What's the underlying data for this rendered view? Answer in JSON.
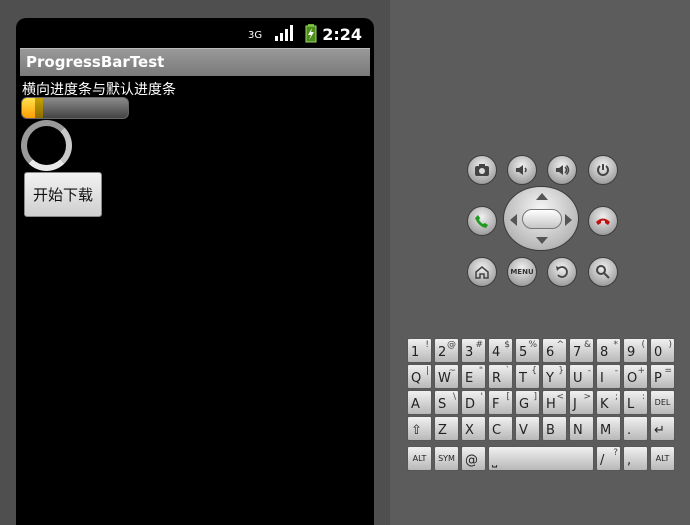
{
  "status_bar": {
    "network_icon": "3g-icon",
    "signal_icon": "signal-icon",
    "battery_icon": "battery-charging-icon",
    "time": "2:24"
  },
  "app": {
    "title": "ProgressBarTest",
    "label": "横向进度条与默认进度条",
    "progress": {
      "primary_fraction": 0.12,
      "secondary_fraction": 0.2,
      "colors": {
        "primary": "#ff9d00",
        "secondary": "#b38d00",
        "track": "#6b6b6b"
      }
    },
    "spinner_icon": "spinner-icon",
    "button_label": "开始下载"
  },
  "emulator": {
    "buttons": {
      "camera": "camera-icon",
      "volume_down": "volume-down-icon",
      "volume_up": "volume-up-icon",
      "power": "power-icon",
      "call": "call-icon",
      "end_call": "end-call-icon",
      "home": "home-icon",
      "menu_label": "MENU",
      "back": "back-icon",
      "search": "search-icon"
    },
    "keyboard": {
      "row1": [
        {
          "k": "1",
          "s": "!"
        },
        {
          "k": "2",
          "s": "@"
        },
        {
          "k": "3",
          "s": "#"
        },
        {
          "k": "4",
          "s": "$"
        },
        {
          "k": "5",
          "s": "%"
        },
        {
          "k": "6",
          "s": "^"
        },
        {
          "k": "7",
          "s": "&"
        },
        {
          "k": "8",
          "s": "*"
        },
        {
          "k": "9",
          "s": "("
        },
        {
          "k": "0",
          "s": ")"
        }
      ],
      "row2": [
        {
          "k": "Q",
          "s": "|"
        },
        {
          "k": "W",
          "s": "~"
        },
        {
          "k": "E",
          "s": "\""
        },
        {
          "k": "R",
          "s": "`"
        },
        {
          "k": "T",
          "s": "{"
        },
        {
          "k": "Y",
          "s": "}"
        },
        {
          "k": "U",
          "s": "-"
        },
        {
          "k": "I",
          "s": "-"
        },
        {
          "k": "O",
          "s": "+"
        },
        {
          "k": "P",
          "s": "="
        }
      ],
      "row3": [
        {
          "k": "A",
          "s": ""
        },
        {
          "k": "S",
          "s": "\\"
        },
        {
          "k": "D",
          "s": "'"
        },
        {
          "k": "F",
          "s": "["
        },
        {
          "k": "G",
          "s": "]"
        },
        {
          "k": "H",
          "s": "<"
        },
        {
          "k": "J",
          "s": ">"
        },
        {
          "k": "K",
          "s": ";"
        },
        {
          "k": "L",
          "s": ":"
        },
        {
          "k": "DEL",
          "s": ""
        }
      ],
      "row4": [
        {
          "k": "⇧",
          "s": ""
        },
        {
          "k": "Z",
          "s": ""
        },
        {
          "k": "X",
          "s": ""
        },
        {
          "k": "C",
          "s": ""
        },
        {
          "k": "V",
          "s": ""
        },
        {
          "k": "B",
          "s": ""
        },
        {
          "k": "N",
          "s": ""
        },
        {
          "k": "M",
          "s": ""
        },
        {
          "k": ".",
          "s": ""
        },
        {
          "k": "↵",
          "s": ""
        }
      ],
      "row5": [
        {
          "k": "ALT",
          "s": ""
        },
        {
          "k": "SYM",
          "s": ""
        },
        {
          "k": "@",
          "s": ""
        },
        {
          "k": "⎵",
          "s": ""
        },
        {
          "k": "/",
          "s": "?"
        },
        {
          "k": ",",
          "s": ""
        },
        {
          "k": "ALT",
          "s": ""
        }
      ]
    }
  }
}
